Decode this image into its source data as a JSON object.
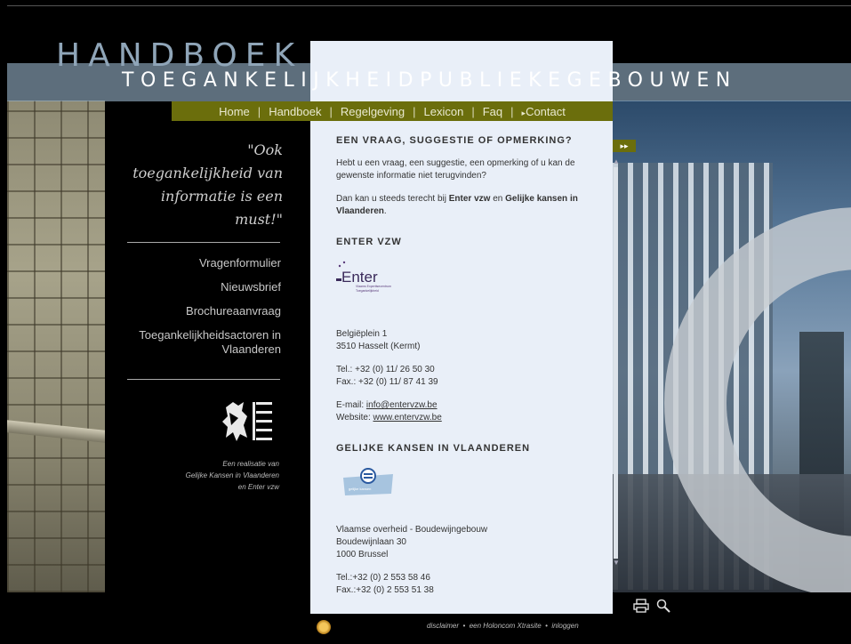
{
  "header": {
    "title": "HANDBOEK",
    "subtitle": "TOEGANKELIJKHEIDPUBLIEKEGEBOUWEN"
  },
  "nav": {
    "items": [
      {
        "label": "Home"
      },
      {
        "label": "Handboek"
      },
      {
        "label": "Regelgeving"
      },
      {
        "label": "Lexicon"
      },
      {
        "label": "Faq"
      },
      {
        "label": "Contact"
      }
    ],
    "separator": "|",
    "contact_arrow": "▸"
  },
  "sidebar": {
    "quote": "\"Ook toegankelijkheid van informatie is een must!\"",
    "links": [
      {
        "label": "Vragenformulier"
      },
      {
        "label": "Nieuwsbrief"
      },
      {
        "label": "Brochureaanvraag"
      },
      {
        "label": "Toegankelijkheidsactoren in Vlaanderen"
      }
    ],
    "credit": [
      "Een realisatie van",
      "Gelijke Kansen in Vlaanderen",
      "en Enter vzw"
    ]
  },
  "content": {
    "heading": "EEN VRAAG, SUGGESTIE OF OPMERKING?",
    "intro": "Hebt u een vraag, een suggestie, een opmerking of u kan de gewenste informatie niet terugvinden?",
    "intro2_pre": "Dan kan u steeds terecht bij ",
    "intro2_enter": "Enter vzw",
    "intro2_mid": " en ",
    "intro2_gk": "Gelijke kansen in Vlaanderen",
    "intro2_post": ".",
    "enter": {
      "heading": "ENTER VZW",
      "logo_text": "Enter",
      "logo_sub1": "Vlaams Expertisecentrum",
      "logo_sub2": "Toegankelijkheid",
      "address1": "Belgiëplein 1",
      "address2": "3510 Hasselt (Kermt)",
      "tel": "Tel.: +32 (0) 11/ 26 50 30",
      "fax": "Fax.: +32 (0) 11/ 87 41 39",
      "email_label": "E-mail: ",
      "email": "info@entervzw.be",
      "website_label": "Website: ",
      "website": "www.entervzw.be"
    },
    "gk": {
      "heading": "GELIJKE KANSEN IN VLAANDEREN",
      "logo_text": "gelijke kansen",
      "address1": "Vlaamse overheid - Boudewijngebouw",
      "address2": "Boudewijnlaan 30",
      "address3": "1000 Brussel",
      "tel": "Tel.:+32 (0) 2 553 58 46",
      "fax": "Fax.:+32 (0) 2 553 51 38"
    }
  },
  "footer": {
    "disclaimer": "disclaimer",
    "dot": "•",
    "holoncom": "een Holoncom Xtrasite",
    "login": "inloggen"
  },
  "colors": {
    "nav_bg": "#6b6e0c",
    "panel_bg": "#e9eff8",
    "title_color": "#8fa5b8"
  },
  "icons": {
    "fast_forward": "▸▸",
    "scroll_up": "▲",
    "scroll_down": "▼"
  }
}
